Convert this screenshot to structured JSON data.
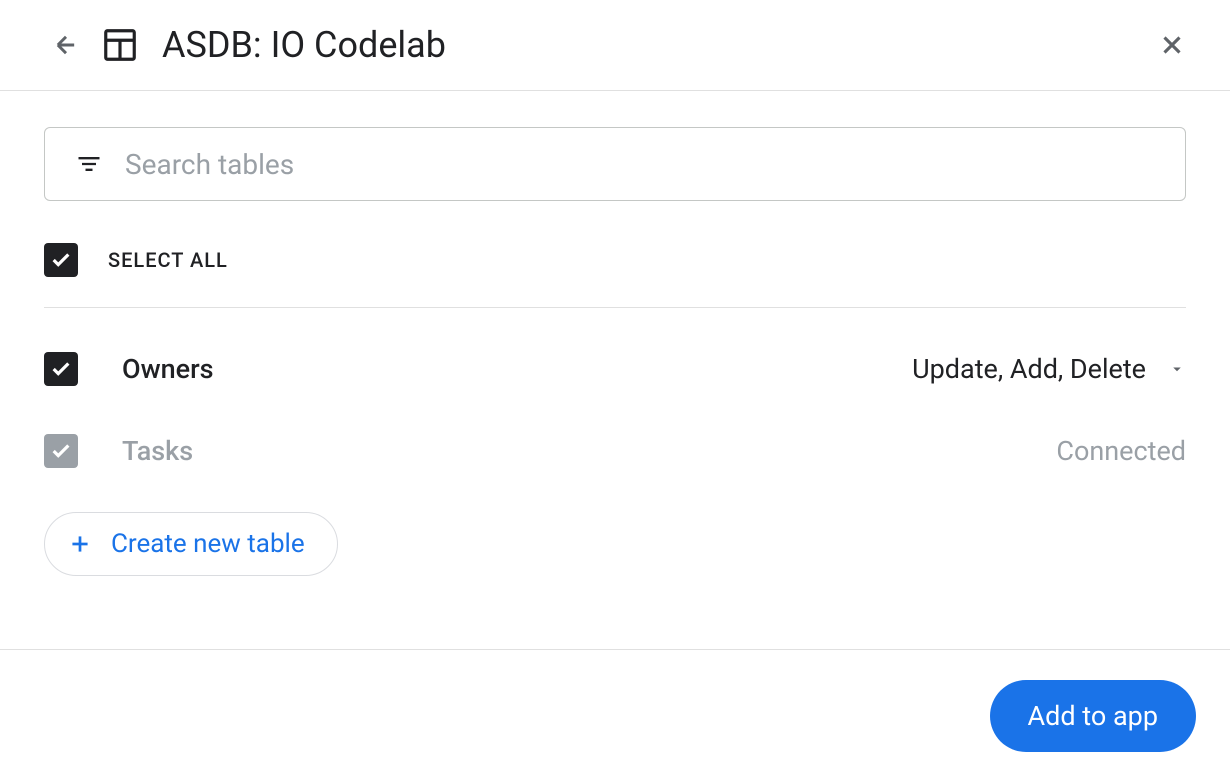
{
  "header": {
    "title": "ASDB: IO Codelab"
  },
  "search": {
    "placeholder": "Search tables"
  },
  "selectAll": {
    "label": "SELECT ALL",
    "checked": true
  },
  "tables": [
    {
      "name": "Owners",
      "checked": true,
      "disabled": false,
      "permissions": "Update, Add, Delete",
      "hasDropdown": true
    },
    {
      "name": "Tasks",
      "checked": true,
      "disabled": true,
      "permissions": "Connected",
      "hasDropdown": false
    }
  ],
  "actions": {
    "createTable": "Create new table",
    "addToApp": "Add to app"
  }
}
